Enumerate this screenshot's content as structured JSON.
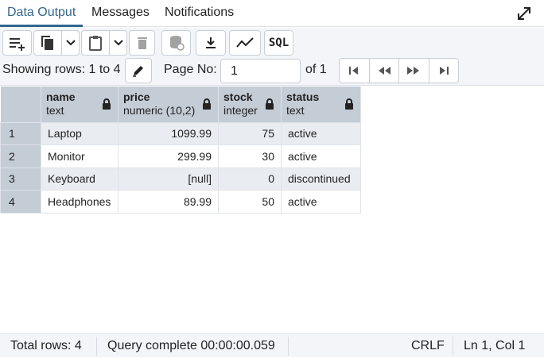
{
  "tabs": [
    {
      "label": "Data Output",
      "active": true
    },
    {
      "label": "Messages",
      "active": false
    },
    {
      "label": "Notifications",
      "active": false
    }
  ],
  "toolbar": {
    "buttons": [
      "add-row-icon",
      "copy-icon",
      "paste-icon",
      "delete-icon",
      "save-data-icon",
      "download-icon",
      "graph-icon",
      "sql-icon"
    ],
    "sql_label": "SQL"
  },
  "pager": {
    "showing_rows": "Showing rows: 1 to 4",
    "page_label": "Page No:",
    "page_value": "1",
    "of_label": "of 1"
  },
  "grid": {
    "columns": [
      {
        "name": "name",
        "type": "text"
      },
      {
        "name": "price",
        "type": "numeric (10,2)"
      },
      {
        "name": "stock",
        "type": "integer"
      },
      {
        "name": "status",
        "type": "text"
      }
    ],
    "rows": [
      {
        "num": "1",
        "name": "Laptop",
        "price": "1099.99",
        "stock": "75",
        "status": "active"
      },
      {
        "num": "2",
        "name": "Monitor",
        "price": "299.99",
        "stock": "30",
        "status": "active"
      },
      {
        "num": "3",
        "name": "Keyboard",
        "price": "[null]",
        "stock": "0",
        "status": "discontinued"
      },
      {
        "num": "4",
        "name": "Headphones",
        "price": "89.99",
        "stock": "50",
        "status": "active"
      }
    ]
  },
  "statusbar": {
    "total_rows": "Total rows: 4",
    "query_status": "Query complete 00:00:00.059",
    "line_ending": "CRLF",
    "cursor_pos": "Ln 1, Col 1"
  },
  "colors": {
    "accent": "#326690",
    "header_bg": "#c4ccd6",
    "toolbar_bg": "#f3f5f9"
  }
}
